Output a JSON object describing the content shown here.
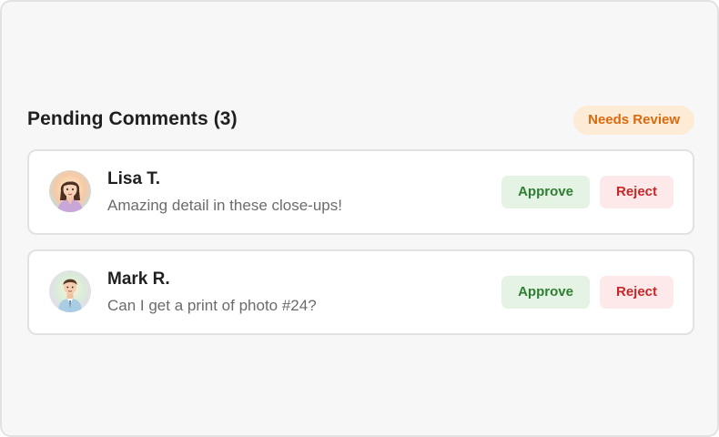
{
  "moderation": {
    "title": "Pending Comments (3)",
    "badge": "Needs Review",
    "approve_label": "Approve",
    "reject_label": "Reject",
    "comments": [
      {
        "author": "Lisa T.",
        "text": "Amazing detail in these close-ups!",
        "avatar_icon": "woman-avatar-icon"
      },
      {
        "author": "Mark R.",
        "text": "Can I get a print of photo #24?",
        "avatar_icon": "man-avatar-icon"
      }
    ]
  },
  "colors": {
    "badge_bg": "#fdebd6",
    "badge_text": "#d96a0d",
    "approve_bg": "#e4f3e4",
    "approve_text": "#2e7d32",
    "reject_bg": "#fde8ea",
    "reject_text": "#c62828"
  }
}
